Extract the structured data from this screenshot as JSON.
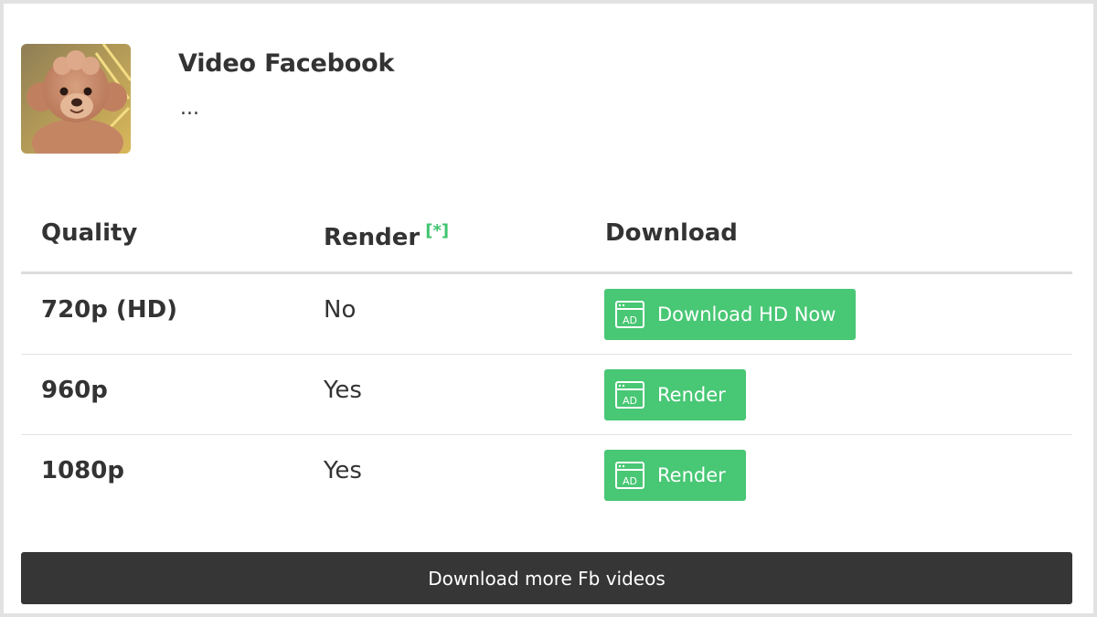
{
  "video": {
    "title": "Video Facebook",
    "subtitle": "...",
    "thumbnail_icon": "poodle-thumbnail"
  },
  "table": {
    "headers": {
      "quality": "Quality",
      "render": "Render",
      "render_note": "[*]",
      "download": "Download"
    },
    "rows": [
      {
        "quality": "720p (HD)",
        "render": "No",
        "button": "Download HD Now"
      },
      {
        "quality": "960p",
        "render": "Yes",
        "button": "Render"
      },
      {
        "quality": "1080p",
        "render": "Yes",
        "button": "Render"
      }
    ]
  },
  "button_icon": "ad-icon",
  "more_button": "Download more Fb videos",
  "colors": {
    "green": "#48c774",
    "dark": "#363636",
    "note": "#3ec46d"
  }
}
